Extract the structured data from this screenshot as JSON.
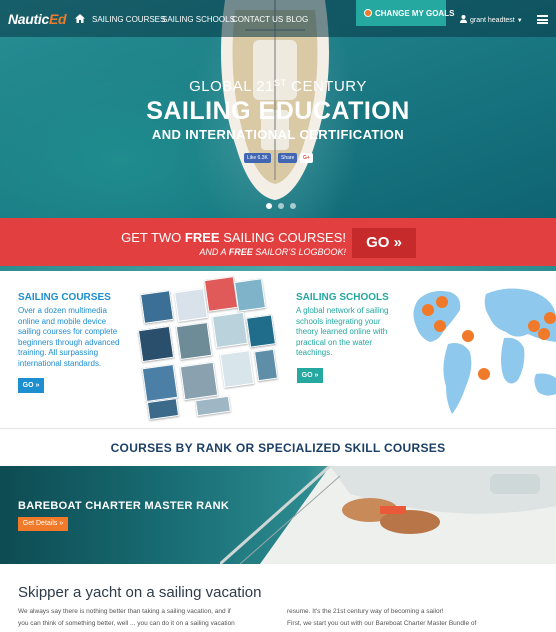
{
  "nav": {
    "logo_main": "Nautic",
    "logo_accent": "Ed",
    "links": [
      "SAILING COURSES",
      "SAILING SCHOOLS",
      "CONTACT US",
      "BLOG"
    ],
    "goals_button": "CHANGE MY GOALS",
    "user_name": "grant headtest"
  },
  "hero": {
    "line1": "GLOBAL 21",
    "line1_sup": "ST",
    "line1_rest": " CENTURY",
    "line2": "SAILING EDUCATION",
    "line3": "AND INTERNATIONAL CERTIFICATION",
    "like_label": "Like 6.3K",
    "share_label": "Share",
    "gplus_label": "G+"
  },
  "promo": {
    "line1_a": "GET TWO ",
    "line1_b": "FREE",
    "line1_c": " SAILING COURSES!",
    "line2_a": "AND A ",
    "line2_b": "FREE",
    "line2_c": " SAILOR'S LOGBOOK!",
    "go_label": "GO »"
  },
  "courses": {
    "title": "SAILING COURSES",
    "lines": [
      "Over a dozen multimedia",
      "online and mobile device",
      "sailing courses for complete",
      "beginners through advanced",
      "training. All surpassing",
      "international standards."
    ],
    "go_label": "GO »"
  },
  "schools": {
    "title": "SAILING SCHOOLS",
    "lines": [
      "A global network of sailing",
      "schools integrating your",
      "theory learned online with",
      "practical on the water",
      "teachings."
    ],
    "go_label": "GO »"
  },
  "rank": {
    "heading": "COURSES BY RANK OR SPECIALIZED SKILL COURSES",
    "banner_title": "BAREBOAT CHARTER MASTER RANK",
    "details_label": "Get Details »"
  },
  "bottom": {
    "title": "Skipper a yacht on a sailing vacation",
    "left_lines": [
      "We always say there is nothing better than taking a sailing vacation, and if",
      "you can think of something better, well ... you can do it on a sailing vacation"
    ],
    "right_lines": [
      "resume.  It's the 21st century way of becoming a sailor!",
      "First, we start you out with our Bareboat Charter Master Bundle of"
    ]
  },
  "colors": {
    "accent_blue": "#1d8ed0",
    "accent_teal": "#24a8a0",
    "promo_red": "#e24040",
    "cta_orange": "#f07a2a"
  }
}
